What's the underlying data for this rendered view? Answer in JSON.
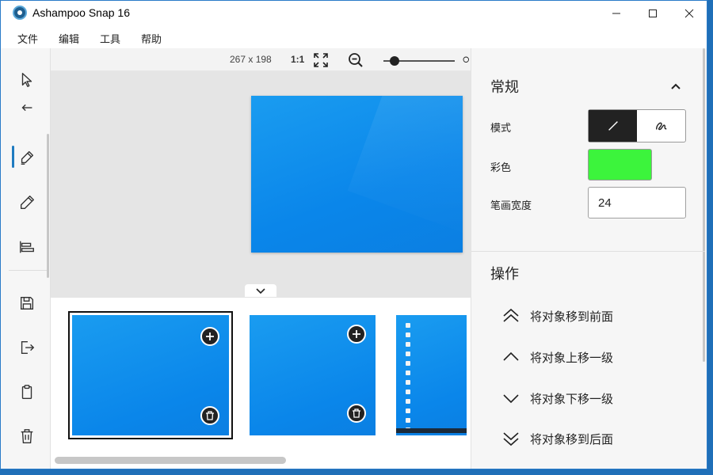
{
  "window": {
    "title": "Ashampoo Snap 16"
  },
  "menu": {
    "items": [
      "文件",
      "编辑",
      "工具",
      "帮助"
    ]
  },
  "tools": {
    "items": [
      "select-icon",
      "undo-icon",
      "marker-icon",
      "pencil-icon",
      "align-icon",
      "save-icon",
      "export-icon",
      "clipboard-icon",
      "trash-icon"
    ],
    "active": "marker-icon"
  },
  "canvas_toolbar": {
    "size": "267 x 198",
    "ratio": "1:1",
    "zoom_level": 0.15
  },
  "properties": {
    "section_general": "常规",
    "mode_label": "模式",
    "color_label": "彩色",
    "color_value": "#3cf43c",
    "width_label": "笔画宽度",
    "width_value": "24",
    "section_actions": "操作",
    "actions": [
      {
        "label": "将对象移到前面",
        "icon": "double-chevron-up-icon"
      },
      {
        "label": "将对象上移一级",
        "icon": "chevron-up-icon"
      },
      {
        "label": "将对象下移一级",
        "icon": "chevron-down-icon"
      },
      {
        "label": "将对象移到后面",
        "icon": "double-chevron-down-icon"
      }
    ]
  },
  "thumbnails": {
    "count_visible": 3,
    "selected_index": 0
  },
  "colors": {
    "accent": "#1f7bc0",
    "canvas_bg": "#e5e5e5",
    "panel_bg": "#f6f6f6"
  }
}
